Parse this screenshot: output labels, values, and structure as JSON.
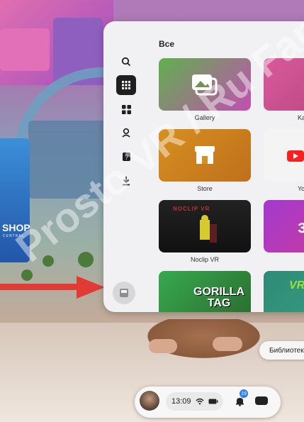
{
  "background": {
    "shop_sign": "SHOP",
    "shop_sub": "CENTRAL"
  },
  "sidebar": {
    "items": [
      {
        "icon": "search-icon",
        "glyph": "⌕"
      },
      {
        "icon": "grid-icon",
        "glyph": "▦",
        "active": true
      },
      {
        "icon": "apps-icon",
        "glyph": "◼"
      },
      {
        "icon": "people-icon",
        "glyph": "☺"
      },
      {
        "icon": "help-icon",
        "glyph": "?"
      },
      {
        "icon": "download-icon",
        "glyph": "⤓"
      }
    ],
    "bottom_icon": "library-icon"
  },
  "main": {
    "section_title": "Все",
    "tiles": [
      {
        "label": "Gallery",
        "color": "#5fb14d",
        "color2": "#c24fb1"
      },
      {
        "label": "Ka",
        "color": "#d85a9b",
        "color2": "#b6447d"
      },
      {
        "label": "Store",
        "color": "#d6901f",
        "color2": "#c06f1c"
      },
      {
        "label": "Yo",
        "color": "#f4f4f4",
        "color2": "#e9e9e9"
      },
      {
        "label": "Noclip VR",
        "color": "#1a1a1a",
        "color2": "#2f2f2f"
      },
      {
        "label": "",
        "color": "#a33ad0",
        "color2": "#ce3a95"
      },
      {
        "label": "",
        "color": "#37a94f",
        "color2": "#2a6b2e",
        "text": "GORILLA TAG"
      },
      {
        "label": "",
        "color": "#2e8a77",
        "color2": "#3aa07f",
        "text": "VR"
      }
    ],
    "noclip_overlay": "NOCLIP VR"
  },
  "library_button": "Библиотек",
  "taskbar": {
    "time": "13:09",
    "wifi_icon": "wifi-icon",
    "battery_icon": "battery-icon",
    "notification_count": "19",
    "headset_icon": "headset-icon"
  },
  "watermark": "Prosto VR / Ru Fans"
}
